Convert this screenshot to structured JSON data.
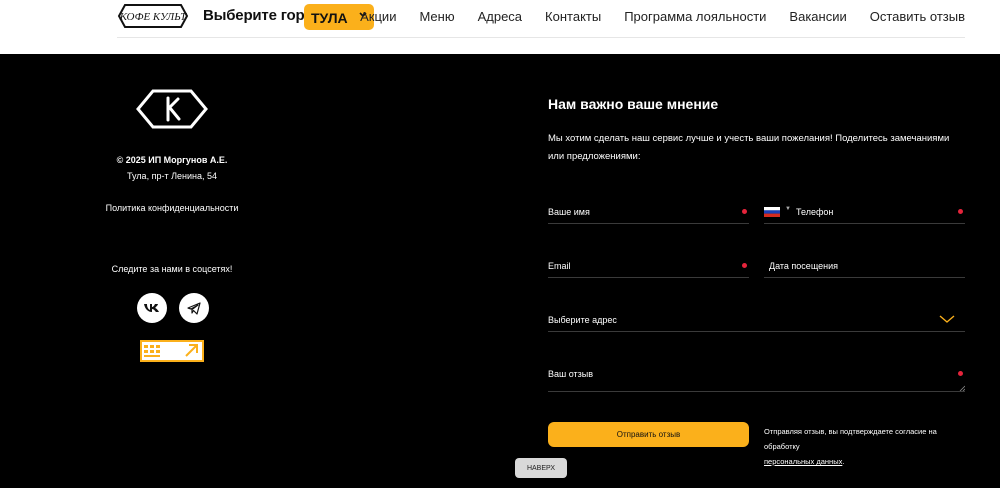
{
  "header": {
    "logo_alt": "КОФЕ КУЛЬТ",
    "city_label": "Выберите город:",
    "city_value": "ТУЛА",
    "nav": [
      "Акции",
      "Меню",
      "Адреса",
      "Контакты",
      "Программа лояльности",
      "Вакансии",
      "Оставить отзыв"
    ]
  },
  "footer": {
    "copyright": "© 2025 ИП Моргунов А.Е.",
    "address": "Тула, пр-т Ленина, 54",
    "privacy": "Политика конфиденциальности",
    "social_heading": "Следите за нами в соцсетях!",
    "socials": [
      "vk-icon",
      "telegram-icon"
    ]
  },
  "form": {
    "title": "Нам важно ваше мнение",
    "description": "Мы хотим сделать наш сервис лучше и учесть ваши пожелания! Поделитесь замечаниями или предложениями:",
    "name_label": "Ваше имя",
    "phone_label": "Телефон",
    "email_label": "Email",
    "date_label": "Дата посещения",
    "address_label": "Выберите адрес",
    "review_label": "Ваш отзыв",
    "submit_label": "Отправить отзыв",
    "consent_text": "Отправляя отзыв, вы подтверждаете согласие на обработку",
    "consent_link": "персональных данных",
    "consent_end": "."
  },
  "to_top": "НАВЕРХ",
  "colors": {
    "accent": "#fbb01b",
    "required_dot": "#e5243b",
    "background": "#000000"
  }
}
